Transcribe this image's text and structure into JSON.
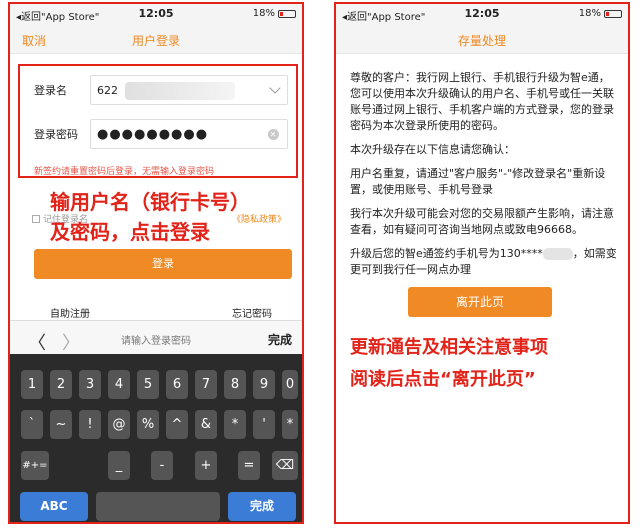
{
  "left": {
    "status": {
      "back": "◂返回\"App Store\"",
      "time": "12:05",
      "battery": "18%"
    },
    "nav": {
      "cancel": "取消",
      "title": "用户登录"
    },
    "form": {
      "username_label": "登录名",
      "username_value": "622",
      "password_label": "登录密码",
      "password_value": "●●●●●●●●●"
    },
    "warning": "新签约请重置密码后登录，无需输入登录密码",
    "annotation": [
      "输用户名（银行卡号）",
      "及密码，点击登录"
    ],
    "remember_label": "记住登录名",
    "privacy_link": "《隐私政策》",
    "login_button": "登录",
    "self_register": "自助注册",
    "forgot_password": "忘记密码",
    "keyboard_toolbar": {
      "prev": "〈",
      "next": "〉",
      "placeholder": "请输入登录密码",
      "done": "完成"
    },
    "keyboard": {
      "row1": [
        "1",
        "2",
        "3",
        "4",
        "5",
        "6",
        "7",
        "8",
        "9",
        "0"
      ],
      "row2": [
        "`",
        "~",
        "!",
        "@",
        "%",
        "^",
        "&",
        "*",
        "'",
        "*"
      ],
      "row3_left": "#+=",
      "row3": [
        "_",
        "-",
        "+",
        "="
      ],
      "delete": "⌫",
      "abc": "ABC",
      "done": "完成"
    }
  },
  "right": {
    "status": {
      "back": "◂返回\"App Store\"",
      "time": "12:05",
      "battery": "18%"
    },
    "nav": {
      "title": "存量处理"
    },
    "notice": {
      "greeting": "尊敬的客户：我行网上银行、手机银行升级为智e通，您可以使用本次升级确认的用户名、手机号或任一关联账号通过网上银行、手机客户端的方式登录，您的登录密码为本次登录所使用的密码。",
      "issues_intro": "本次升级存在以下信息请您确认：",
      "duplicate": "用户名重复，请通过\"客户服务\"-\"修改登录名\"重新设置，或使用账号、手机号登录",
      "limits": "我行本次升级可能会对您的交易限额产生影响，请注意查看，如有疑问可咨询当地网点或致电96668。",
      "phone_prefix": "升级后您的智e通签约手机号为130****",
      "phone_suffix": "，如需变更可到我行任一网点办理"
    },
    "leave_button": "离开此页",
    "instruction": [
      "更新通告及相关注意事项",
      "阅读后点击“离开此页”"
    ]
  }
}
